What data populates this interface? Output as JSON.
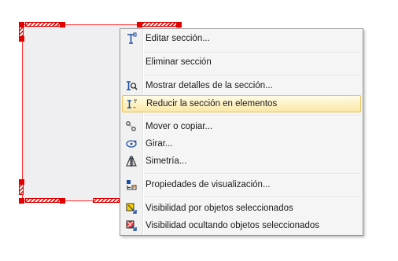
{
  "menu": {
    "items": [
      {
        "label": "Editar sección...",
        "icon": "edit-section-icon"
      },
      {
        "label": "Eliminar sección",
        "icon": ""
      },
      {
        "label": "Mostrar detalles de la sección...",
        "icon": "section-details-icon"
      },
      {
        "label": "Reducir la sección en elementos",
        "icon": "reduce-section-icon"
      },
      {
        "label": "Mover o copiar...",
        "icon": "move-copy-icon"
      },
      {
        "label": "Girar...",
        "icon": "rotate-icon"
      },
      {
        "label": "Simetría...",
        "icon": "mirror-icon"
      },
      {
        "label": "Propiedades de visualización...",
        "icon": "display-properties-icon"
      },
      {
        "label": "Visibilidad por objetos seleccionados",
        "icon": "visibility-selected-icon"
      },
      {
        "label": "Visibilidad ocultando objetos seleccionados",
        "icon": "visibility-hide-selected-icon"
      }
    ],
    "highlighted_item": "Reducir la sección en elementos"
  },
  "colors": {
    "section_outline": "#ff2a2a",
    "section_fill": "#efeff1",
    "highlight_fill": "#fbe9a6",
    "highlight_border": "#e6c562",
    "icon_blue": "#1f4fa0"
  }
}
